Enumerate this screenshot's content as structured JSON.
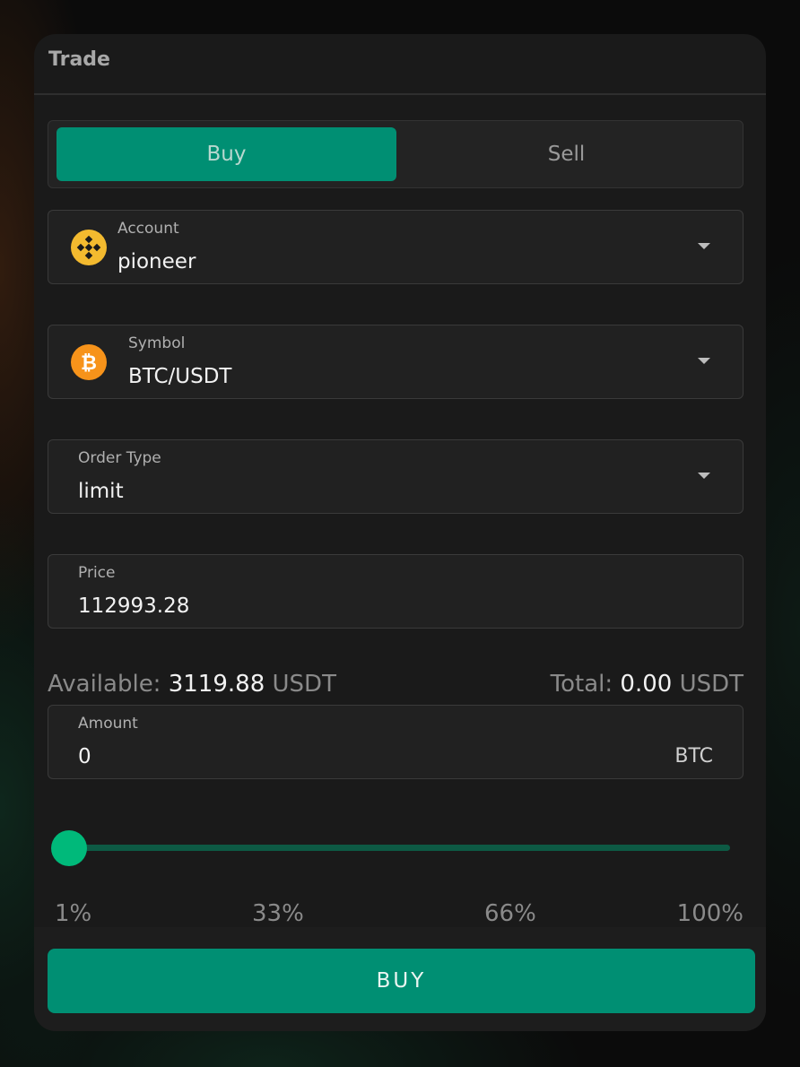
{
  "card": {
    "title": "Trade"
  },
  "side_toggle": {
    "buy_label": "Buy",
    "sell_label": "Sell",
    "selected": "Buy"
  },
  "account": {
    "label": "Account",
    "value": "pioneer",
    "icon": "binance-icon",
    "icon_color": "#F3BA2F"
  },
  "symbol": {
    "label": "Symbol",
    "value": "BTC/USDT",
    "icon": "bitcoin-icon",
    "icon_color": "#F7931A"
  },
  "order_type": {
    "label": "Order Type",
    "value": "limit"
  },
  "price": {
    "label": "Price",
    "value": "112993.28"
  },
  "balances": {
    "available_label": "Available:",
    "available_value": "3119.88",
    "available_unit": "USDT",
    "total_label": "Total:",
    "total_value": "0.00",
    "total_unit": "USDT"
  },
  "amount": {
    "label": "Amount",
    "value": "0",
    "unit": "BTC"
  },
  "slider": {
    "value_fraction": 0,
    "marks": [
      "1%",
      "33%",
      "66%",
      "100%"
    ],
    "track_color": "#0d5a44",
    "thumb_color": "#00b97a"
  },
  "submit": {
    "label": "BUY",
    "color": "#008f73"
  }
}
